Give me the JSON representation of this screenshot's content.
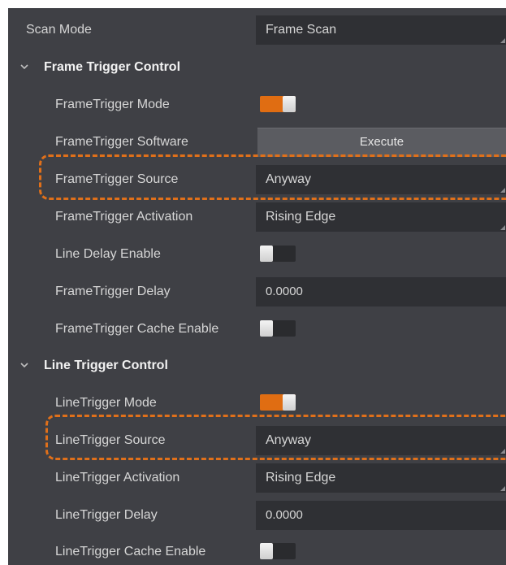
{
  "scan_mode": {
    "label": "Scan Mode",
    "value": "Frame Scan"
  },
  "frame_trigger": {
    "title": "Frame Trigger Control",
    "mode_label": "FrameTrigger Mode",
    "mode_on": true,
    "software_label": "FrameTrigger Software",
    "execute_label": "Execute",
    "source_label": "FrameTrigger Source",
    "source_value": "Anyway",
    "activation_label": "FrameTrigger Activation",
    "activation_value": "Rising Edge",
    "line_delay_label": "Line Delay Enable",
    "line_delay_on": false,
    "delay_label": "FrameTrigger Delay",
    "delay_value": "0.0000",
    "cache_label": "FrameTrigger Cache Enable",
    "cache_on": false
  },
  "line_trigger": {
    "title": "Line Trigger Control",
    "mode_label": "LineTrigger Mode",
    "mode_on": true,
    "source_label": "LineTrigger Source",
    "source_value": "Anyway",
    "activation_label": "LineTrigger Activation",
    "activation_value": "Rising Edge",
    "delay_label": "LineTrigger Delay",
    "delay_value": "0.0000",
    "cache_label": "LineTrigger Cache Enable",
    "cache_on": false
  },
  "colors": {
    "panel_bg": "#3f4045",
    "field_bg": "#2f3034",
    "accent_orange": "#e06d12",
    "highlight_dash": "#e0701a"
  }
}
